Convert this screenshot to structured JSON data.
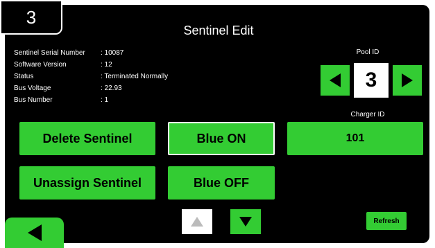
{
  "header": {
    "screen_number": "3",
    "title": "Sentinel Edit"
  },
  "info": [
    {
      "label": "Sentinel Serial Number",
      "value": ": 10087"
    },
    {
      "label": "Software Version",
      "value": ": 12"
    },
    {
      "label": "Status",
      "value": ": Terminated Normally"
    },
    {
      "label": "Bus Voltage",
      "value": ": 22.93"
    },
    {
      "label": "Bus Number",
      "value": ": 1"
    }
  ],
  "pool": {
    "label": "Pool ID",
    "value": "3",
    "prev_icon": "triangle-left-icon",
    "next_icon": "triangle-right-icon"
  },
  "charger": {
    "label": "Charger ID",
    "value": "101"
  },
  "buttons": {
    "delete": "Delete Sentinel",
    "unassign": "Unassign Sentinel",
    "blue_on": "Blue ON",
    "blue_off": "Blue OFF",
    "refresh": "Refresh"
  },
  "colors": {
    "accent_green": "#33cc33",
    "background": "#000000",
    "text": "#ffffff"
  }
}
